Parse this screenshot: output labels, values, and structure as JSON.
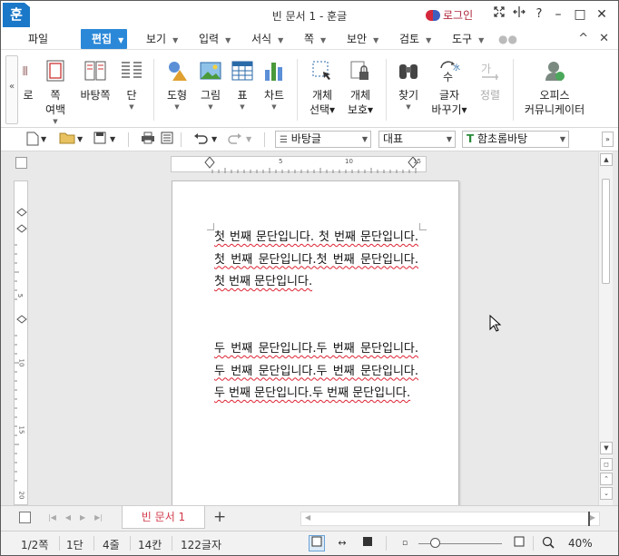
{
  "titlebar": {
    "app_logo": "훈",
    "title": "빈 문서 1 - 훈글",
    "login": "로그인",
    "icons": [
      "expand-icon",
      "split-icon",
      "help-icon"
    ],
    "help_label": "?",
    "controls": {
      "minimize": "–",
      "restore": "□",
      "close": "✕"
    }
  },
  "menubar": {
    "items": [
      {
        "label": "파일"
      },
      {
        "label": "편집",
        "active": true
      },
      {
        "label": "보기"
      },
      {
        "label": "입력"
      },
      {
        "label": "서식"
      },
      {
        "label": "쪽"
      },
      {
        "label": "보안"
      },
      {
        "label": "검토"
      },
      {
        "label": "도구"
      }
    ],
    "right": {
      "collapse": "^",
      "close": "✕"
    }
  },
  "ribbon": {
    "collapse_handle": "«",
    "buttons": [
      {
        "label": "로",
        "icon": "paper-size-icon"
      },
      {
        "label": "쪽",
        "sub": "여백",
        "icon": "page-margin-icon"
      },
      {
        "label": "바탕쪽",
        "icon": "master-page-icon"
      },
      {
        "label": "단",
        "icon": "columns-icon"
      },
      {
        "label": "도형",
        "icon": "shape-icon"
      },
      {
        "label": "그림",
        "icon": "picture-icon"
      },
      {
        "label": "표",
        "icon": "table-icon"
      },
      {
        "label": "차트",
        "icon": "chart-icon"
      },
      {
        "label": "개체",
        "sub": "선택",
        "icon": "object-select-icon"
      },
      {
        "label": "개체",
        "sub": "보호",
        "icon": "object-protect-icon"
      },
      {
        "label": "찾기",
        "icon": "find-icon"
      },
      {
        "label": "글자",
        "sub": "바꾸기",
        "icon": "char-convert-icon"
      },
      {
        "label": "정렬",
        "icon": "sort-icon",
        "disabled": true
      },
      {
        "label": "오피스",
        "sub": "커뮤니케이터",
        "icon": "office-communicator-icon"
      }
    ]
  },
  "toolbar2": {
    "style_combo": "바탕글",
    "outline_combo": "대표",
    "font_combo": "함초롬바탕",
    "font_icon": "T"
  },
  "ruler": {
    "h_ticks": [
      "5",
      "10",
      "15"
    ],
    "v_ticks": [
      "5",
      "10",
      "15",
      "20"
    ]
  },
  "document": {
    "paragraphs": [
      "첫 번째 문단입니다. 첫 번째 문단입니다.첫 번째 문단입니다.첫 번째 문단입니다.첫 번째 문단입니다.",
      "두 번째 문단입니다.두 번째 문단입니다.두 번째 문단입니다.두 번째 문단입니다.두 번째 문단입니다.두 번째 문단입니다."
    ]
  },
  "tabs": {
    "doc_tab": "빈 문서 1",
    "add": "+"
  },
  "status": {
    "page": "1/2쪽",
    "column": "1단",
    "line": "4줄",
    "col": "14칸",
    "chars": "122글자",
    "zoom": "40%",
    "zoom_level": 0.2
  }
}
